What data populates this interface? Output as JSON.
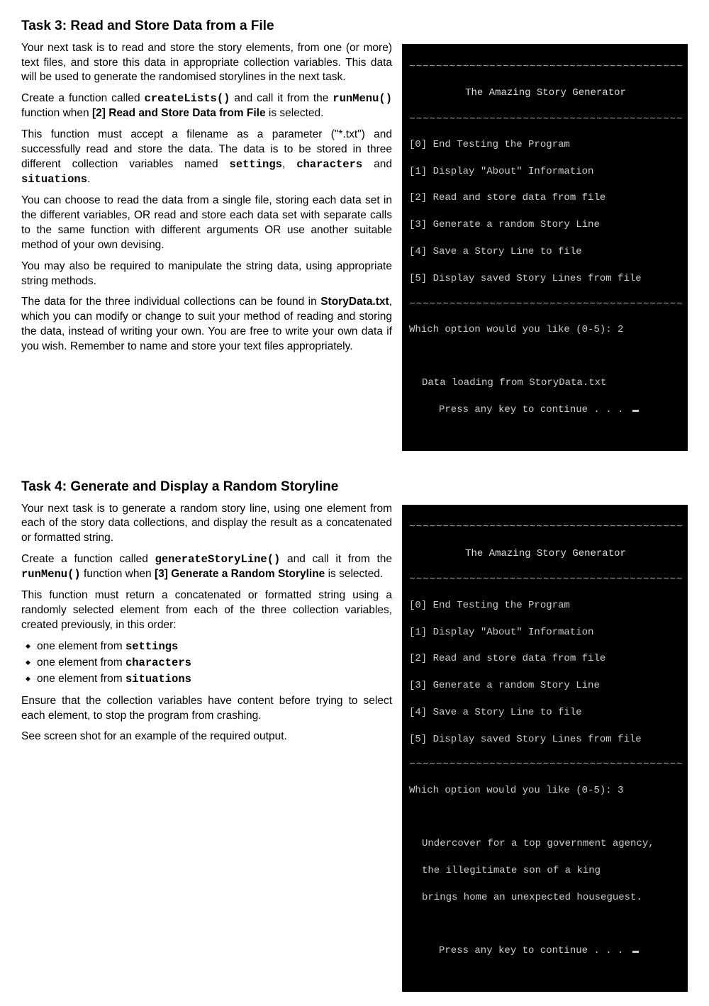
{
  "task3": {
    "heading": "Task 3: Read and Store Data from a File",
    "p1": "Your next task is to read and store the story elements, from one (or more) text files, and store this data in appropriate collection variables. This data will be used to generate the randomised storylines in the next task.",
    "p2a": "Create a function called ",
    "p2_code1": "createLists()",
    "p2b": " and call it from the ",
    "p2_code2": "runMenu()",
    "p2c": " function when ",
    "p2_bold": "[2] Read and Store Data from File",
    "p2d": " is selected.",
    "p3a": "This function must accept a filename as a parameter (\"*.txt\") and successfully read and store the data. The data is to be stored in three different collection variables named ",
    "p3_code1": "settings",
    "p3_sep1": ", ",
    "p3_code2": "characters",
    "p3_sep2": " and ",
    "p3_code3": "situations",
    "p3_end": ".",
    "p4": "You can choose to read the data from a single file, storing each data set in the different variables, OR read and store each data set with separate calls to the same function with different arguments OR use another suitable method of your own devising.",
    "p5": "You may also be required to manipulate the string data, using appropriate string methods.",
    "p6a": "The data for the three individual collections can be found in ",
    "p6_bold": "StoryData.txt",
    "p6b": ", which you can modify or change to suit your method of reading and storing the data, instead of writing your own. You are free to write your own data if you wish. Remember to name and store your text files appropriately."
  },
  "task4": {
    "heading": "Task 4: Generate and Display a Random Storyline",
    "p1": "Your next task is to generate a random story line, using one element from each of the story data collections, and display the result as a concatenated or formatted string.",
    "p2a": "Create a function called ",
    "p2_code1": "generateStoryLine()",
    "p2b": " and call it from the ",
    "p2_code2": "runMenu()",
    "p2c": " function when ",
    "p2_bold": "[3] Generate a Random Storyline",
    "p2d": " is selected.",
    "p3": "This function must return a concatenated or formatted string using a randomly selected element from each of the three collection variables, created previously, in this order:",
    "bullets": {
      "b1a": "one element from ",
      "b1_code": "settings",
      "b2a": "one element from ",
      "b2_code": "characters",
      "b3a": "one element from ",
      "b3_code": "situations"
    },
    "p4": "Ensure that the collection variables have content before trying to select each element, to stop the program from crashing.",
    "p5": "See screen shot for an example of the required output."
  },
  "terminal_common": {
    "wave": "∼∼∼∼∼∼∼∼∼∼∼∼∼∼∼∼∼∼∼∼∼∼∼∼∼∼∼∼∼∼∼∼∼∼∼∼∼∼∼∼∼∼∼∼∼∼∼∼∼∼∼∼∼∼∼∼∼∼∼∼∼∼∼∼∼",
    "title": "The Amazing Story Generator",
    "menu0": "[0] End Testing the Program",
    "menu1": "[1] Display \"About\" Information",
    "menu2": "[2] Read and store data from file",
    "menu3": "[3] Generate a random Story Line",
    "menu4": "[4] Save a Story Line to file",
    "menu5": "[5] Display saved Story Lines from file",
    "continue": "Press any key to continue . . . "
  },
  "terminal1": {
    "prompt": "Which option would you like (0-5): 2",
    "loading": "Data loading from StoryData.txt"
  },
  "terminal2": {
    "prompt": "Which option would you like (0-5): 3",
    "out1": "Undercover for a top government agency,",
    "out2": "the illegitimate son of a king",
    "out3": "brings home an unexpected houseguest."
  }
}
